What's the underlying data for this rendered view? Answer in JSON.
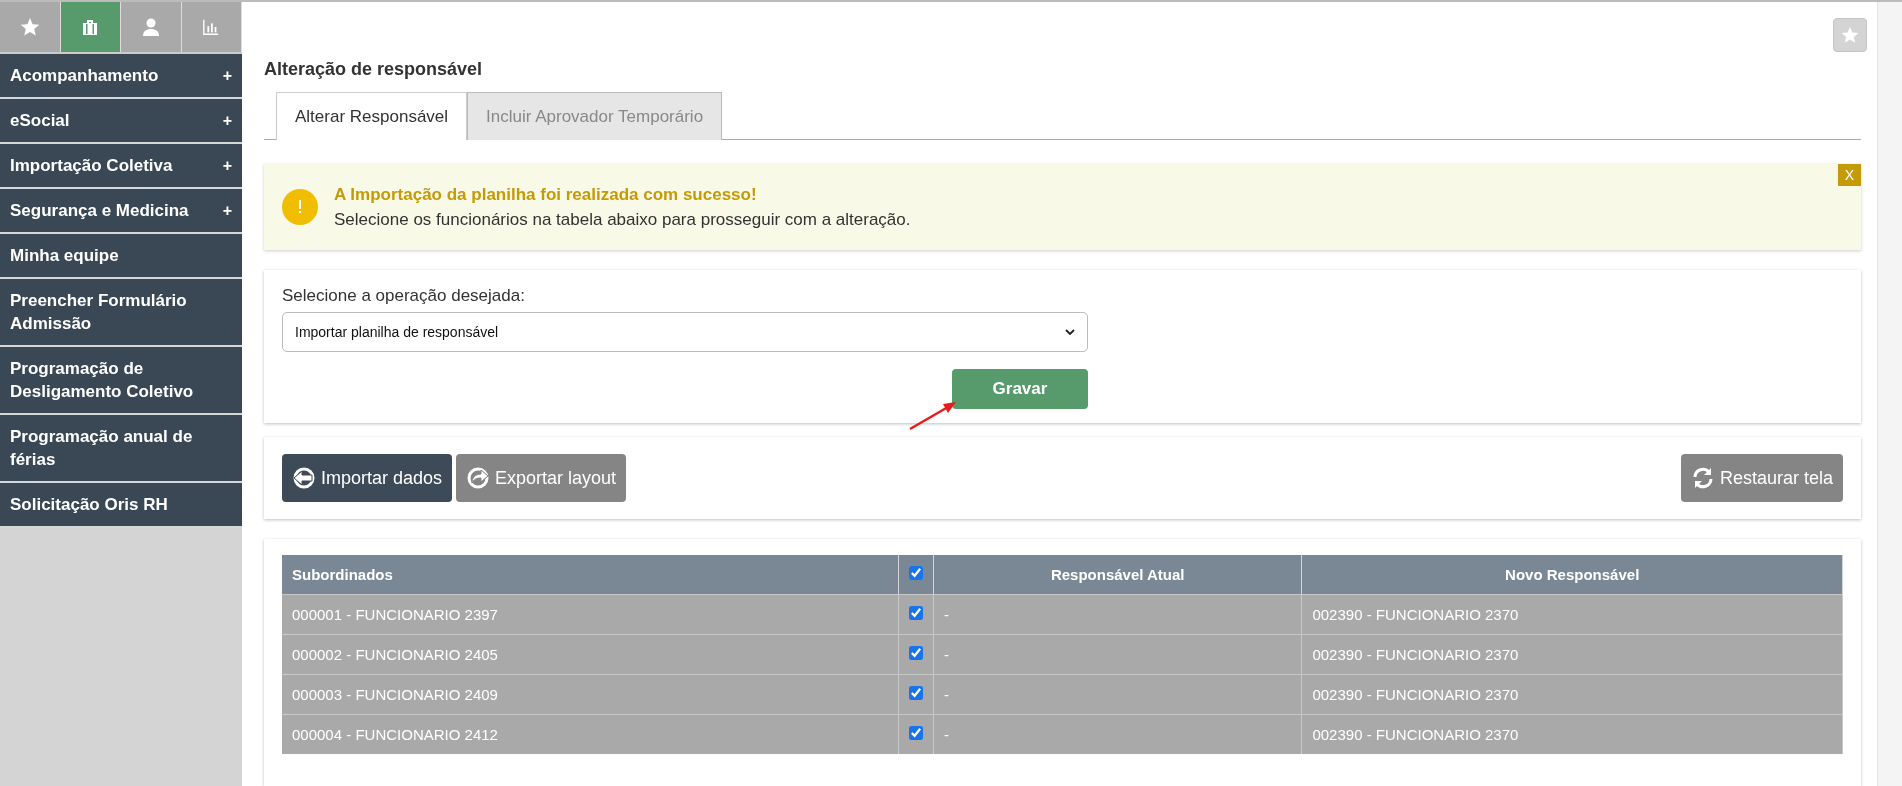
{
  "sidebar": {
    "icon_tabs": [
      {
        "kind": "star",
        "selected": false
      },
      {
        "kind": "briefcase",
        "selected": true
      },
      {
        "kind": "person",
        "selected": false
      },
      {
        "kind": "chart",
        "selected": false
      }
    ],
    "items": [
      {
        "label": "Acompanhamento",
        "toggle": "+"
      },
      {
        "label": "eSocial",
        "toggle": "+"
      },
      {
        "label": "Importação Coletiva",
        "toggle": "+"
      },
      {
        "label": "Segurança e Medicina",
        "toggle": "+"
      },
      {
        "label": "Minha equipe"
      },
      {
        "label": "Preencher Formulário Admissão"
      },
      {
        "label": "Programação de Desligamento Coletivo"
      },
      {
        "label": "Programação anual de férias"
      },
      {
        "label": "Solicitação Oris RH"
      }
    ]
  },
  "page": {
    "title": "Alteração de responsável",
    "favorite": false
  },
  "tabs": [
    {
      "label": "Alterar Responsável",
      "selected": true
    },
    {
      "label": "Incluir Aprovador Temporário",
      "selected": false
    }
  ],
  "alert": {
    "title": "A Importação da planilha foi realizada com sucesso!",
    "message": "Selecione os funcionários na tabela abaixo para prosseguir com a alteração.",
    "close": "X"
  },
  "form": {
    "label": "Selecione a operação desejada:",
    "value": "Importar planilha de responsável",
    "submit": "Gravar"
  },
  "actions": [
    {
      "label": "Importar dados",
      "kind": "import"
    },
    {
      "label": "Exportar layout",
      "kind": "export"
    },
    {
      "label": "Restaurar tela",
      "kind": "restore"
    }
  ],
  "table": {
    "columns": [
      "Subordinados",
      "Responsável Atual",
      "Novo Responsável"
    ],
    "all_checked": true,
    "rows": [
      {
        "subordinate": "000001 - FUNCIONARIO 2397",
        "checked": true,
        "current": "-",
        "new": "002390 - FUNCIONARIO 2370"
      },
      {
        "subordinate": "000002 - FUNCIONARIO 2405",
        "checked": true,
        "current": "-",
        "new": "002390 - FUNCIONARIO 2370"
      },
      {
        "subordinate": "000003 - FUNCIONARIO 2409",
        "checked": true,
        "current": "-",
        "new": "002390 - FUNCIONARIO 2370"
      },
      {
        "subordinate": "000004 - FUNCIONARIO 2412",
        "checked": true,
        "current": "-",
        "new": "002390 - FUNCIONARIO 2370"
      }
    ]
  }
}
